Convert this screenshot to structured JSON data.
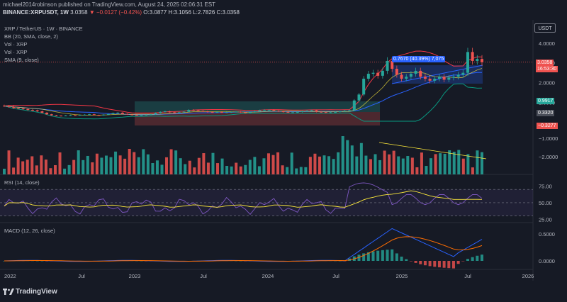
{
  "header": {
    "publisher_line": "michael2014robinson published on TradingView.com, August 24, 2025 02:06:31 EST",
    "symbol": "BINANCE:XRPUSDT, 1W",
    "last": "3.0358",
    "change": "−0.0127 (−0.42%)",
    "open": "O:3.0877",
    "high": "H:3.1056",
    "low": "L:2.7826",
    "close": "C:3.0358"
  },
  "legend": {
    "title": "XRP / TetherUS · 1W · BINANCE",
    "bb": "BB (20, SMA, close, 2)",
    "vol1": "Vol · XRP",
    "vol2": "Vol · XRP",
    "sma": "SMA (9, close)",
    "rsi": "RSI (14, close)",
    "macd": "MACD (12, 26, close)"
  },
  "currency_button": "USDT",
  "range_label": "0.7670 (40.39%) 7,075",
  "price_labels": {
    "last": "3.0358",
    "countdown": "16:53:30",
    "p1": "0.9917",
    "p2": "0.3320",
    "p3": "−0.3277"
  },
  "branding": "TradingView",
  "colors": {
    "background": "#161a25",
    "up": "#26a69a",
    "down": "#ef5350",
    "bb_band": "#2962ff",
    "rsi_line": "#7e57c2",
    "macd_line": "#2962ff",
    "signal_line": "#ff6d00"
  },
  "chart_data": [
    {
      "name": "price",
      "type": "line",
      "x_labels": [
        "2022",
        "Jul",
        "2023",
        "Jul",
        "2024",
        "Jul",
        "2025",
        "Jul",
        "2026"
      ],
      "y_ticks": [
        4.0,
        3.0,
        2.0,
        1.0
      ],
      "y_tick_labels": [
        "4.0000",
        "3.0000",
        "2.0000",
        "1.0000"
      ],
      "close": [
        0.82,
        0.78,
        0.72,
        0.7,
        0.66,
        0.62,
        0.6,
        0.55,
        0.48,
        0.4,
        0.35,
        0.33,
        0.32,
        0.34,
        0.36,
        0.35,
        0.37,
        0.38,
        0.4,
        0.36,
        0.35,
        0.38,
        0.41,
        0.46,
        0.48,
        0.42,
        0.39,
        0.37,
        0.36,
        0.36,
        0.38,
        0.4,
        0.47,
        0.52,
        0.55,
        0.5,
        0.47,
        0.5,
        0.53,
        0.62,
        0.6,
        0.57,
        0.55,
        0.52,
        0.5,
        0.52,
        0.5,
        0.5,
        0.52,
        0.53,
        0.5,
        0.48,
        0.51,
        0.55,
        0.6,
        0.62,
        0.62,
        0.58,
        0.55,
        0.52,
        0.5,
        0.5,
        0.52,
        0.55,
        0.58,
        0.6,
        0.53,
        0.51,
        0.49,
        0.5,
        0.52,
        0.55,
        0.58,
        0.6,
        1.1,
        1.4,
        2.2,
        2.45,
        2.5,
        2.35,
        2.6,
        3.1,
        2.7,
        2.4,
        2.2,
        2.3,
        2.45,
        2.6,
        2.3,
        2.2,
        2.1,
        2.2,
        2.3,
        2.15,
        2.25,
        2.3,
        2.4,
        2.5,
        3.55,
        3.1,
        3.2,
        3.04
      ],
      "volume_bars": 104,
      "volume_scale_ticks": [
        "−1.0000",
        "−2.0000"
      ]
    },
    {
      "name": "RSI",
      "type": "line",
      "y_ticks": [
        75.0,
        50.0,
        25.0
      ],
      "y_tick_labels": [
        "75.00",
        "50.00",
        "25.00"
      ],
      "band": [
        30,
        70
      ]
    },
    {
      "name": "MACD",
      "type": "line",
      "y_ticks": [
        0.5,
        0.0
      ],
      "y_tick_labels": [
        "0.5000",
        "0.0000"
      ]
    }
  ]
}
